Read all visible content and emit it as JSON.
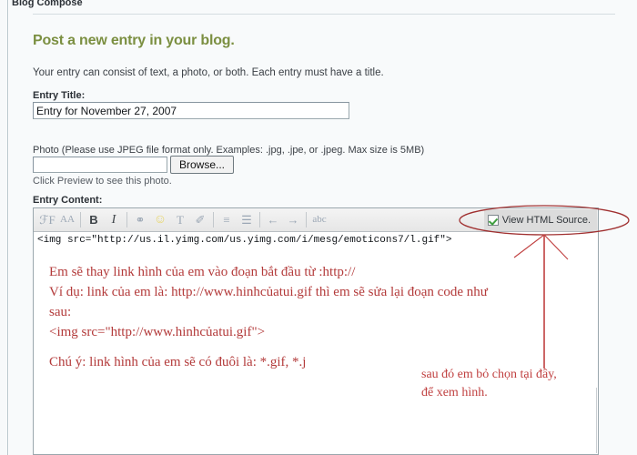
{
  "breadcrumb": "Blog Compose",
  "headline": "Post a new entry in your blog.",
  "intro": "Your entry can consist of text, a photo, or both. Each entry must have a title.",
  "form": {
    "entry_title_label": "Entry Title:",
    "entry_title_value": "Entry for November 27, 2007",
    "photo_note": "Photo (Please use JPEG file format only. Examples: .jpg, .jpe, or .jpeg. Max size is 5MB)",
    "photo_value": "",
    "photo_placeholder": "",
    "browse_label": "Browse...",
    "preview_note": "Click Preview to see this photo.",
    "entry_content_label": "Entry Content:"
  },
  "toolbar": {
    "buttons": [
      {
        "name": "font-family-icon",
        "glyph": "ℱF",
        "title": "Font"
      },
      {
        "name": "font-size-icon",
        "glyph": "AA",
        "title": "Font size"
      },
      {
        "name": "bold-icon",
        "glyph": "B",
        "title": "Bold"
      },
      {
        "name": "italic-icon",
        "glyph": "I",
        "title": "Italic"
      },
      {
        "name": "insert-link-icon",
        "glyph": "⚭",
        "title": "Link"
      },
      {
        "name": "emoticon-icon",
        "glyph": "☺",
        "title": "Emoticons"
      },
      {
        "name": "text-color-icon",
        "glyph": "T",
        "title": "Text color"
      },
      {
        "name": "highlighter-icon",
        "glyph": "✐",
        "title": "Highlight"
      },
      {
        "name": "align-icon",
        "glyph": "≡",
        "title": "Align"
      },
      {
        "name": "bullet-list-icon",
        "glyph": "☰",
        "title": "List"
      },
      {
        "name": "outdent-icon",
        "glyph": "←",
        "title": "Outdent"
      },
      {
        "name": "indent-icon",
        "glyph": "→",
        "title": "Indent"
      },
      {
        "name": "spellcheck-icon",
        "glyph": "abc",
        "title": "Spell check"
      }
    ],
    "view_html_source_label": "View HTML Source.",
    "view_html_source_checked": true
  },
  "editor": {
    "source_line": "<img src=\"http://us.il.yimg.com/us.yimg.com/i/mesg/emoticons7/l.gif\">",
    "content_lines": [
      "Em sẽ thay link hình của em vào đoạn bắt đầu từ :http://",
      "Ví dụ: link của em là: http://www.hinhcủatui.gif thì em sẽ sửa lại đoạn code như",
      "sau:",
      "<img src=\"http://www.hinhcủatui.gif\">"
    ],
    "note_line": "Chú ý: link hình của em sẽ có đuôi là: *.gif, *.j"
  },
  "annotation": {
    "lines": [
      "sau đó em bỏ chọn tại đây,",
      "để xem hình."
    ],
    "ink_color": "#c04040",
    "ellipse_color": "#a03030"
  },
  "colors": {
    "headline": "#7b8f41",
    "page_bg": "#f8fafb",
    "editor_text": "#b33a3a"
  }
}
